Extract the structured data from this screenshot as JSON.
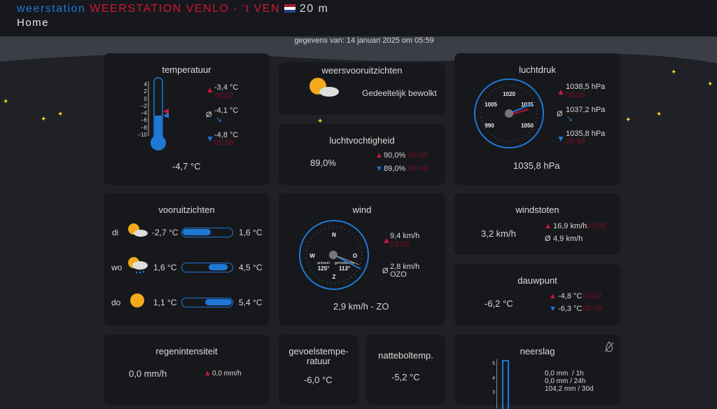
{
  "header": {
    "site": "weerstation",
    "station": "WEERSTATION VENLO - 't VEN",
    "altitude": "20 m",
    "nav": "Home"
  },
  "updated": "gegevens van: 14 januari 2025 om 05:59",
  "colors": {
    "accent": "#1e78d6",
    "high": "#d0153a",
    "time": "#7a0f2a"
  },
  "temperature": {
    "title": "temperatuur",
    "current": "-4,7 °C",
    "current_value": -4.7,
    "scale": [
      "4",
      "2",
      "0",
      "−2",
      "−4",
      "−6",
      "−8",
      "−10"
    ],
    "max": "-3,4 °C",
    "max_time": "00:02",
    "avg_symbol": "Ø",
    "avg": "-4,1 °C",
    "min": "-4,8 °C",
    "min_time": "05:58"
  },
  "forecast": {
    "title": "weersvooruitzichten",
    "text": "Gedeeltelijk bewolkt",
    "icon": "partly-cloudy-icon"
  },
  "humidity": {
    "title": "luchtvochtigheid",
    "current": "89,0%",
    "max": "90,0%",
    "max_time": "00:00",
    "min": "89,0%",
    "min_time": "00:06"
  },
  "pressure": {
    "title": "luchtdruk",
    "current": "1035,8 hPa",
    "current_value": 1035.8,
    "dial": [
      "990",
      "1005",
      "1020",
      "1035",
      "1050"
    ],
    "max": "1038,5 hPa",
    "max_time": "00:09",
    "avg_symbol": "Ø",
    "avg": "1037,2 hPa",
    "min": "1035,8 hPa",
    "min_time": "05:59"
  },
  "outlook": {
    "title": "vooruitzichten",
    "days": [
      {
        "day": "di",
        "icon": "partly-cloudy-icon",
        "min": "-2,7 °C",
        "max": "1,6 °C",
        "range": [
          0,
          0.55
        ]
      },
      {
        "day": "wo",
        "icon": "cloud-rain-icon",
        "min": "1,6 °C",
        "max": "4,5 °C",
        "range": [
          0.52,
          0.88
        ]
      },
      {
        "day": "do",
        "icon": "sun-icon",
        "min": "1,1 °C",
        "max": "5,4 °C",
        "range": [
          0.45,
          1
        ]
      }
    ]
  },
  "wind": {
    "title": "wind",
    "current": "2,9 km/h - ZO",
    "dirs": [
      "N",
      "O",
      "Z",
      "W"
    ],
    "actual_label": "actueel",
    "actual": "125°",
    "avg_label": "gemiddelde",
    "avg": "113°",
    "max": "9,4 km/h",
    "max_time": "03:05",
    "avg_symbol": "Ø",
    "avg_speed": "2,8 km/h",
    "avg_dir": "OZO"
  },
  "gusts": {
    "title": "windstoten",
    "current": "3,2 km/h",
    "max": "16,9 km/h",
    "max_time": "03:05",
    "avg_symbol": "Ø",
    "avg": "4,9 km/h"
  },
  "dewpoint": {
    "title": "dauwpunt",
    "current": "-6,2 °C",
    "max": "-4,8 °C",
    "max_time": "00:02",
    "min": "-6,3 °C",
    "min_time": "05:58"
  },
  "rain_rate": {
    "title": "regenintensiteit",
    "current": "0,0 mm/h",
    "max": "0,0 mm/h"
  },
  "feels": {
    "title": "gevoelstempe-ratuur",
    "current": "-6,0 °C"
  },
  "wetbulb": {
    "title": "natteboltemp.",
    "current": "-5,2 °C"
  },
  "precip": {
    "title": "neerslag",
    "scale": [
      "5",
      "4",
      "3"
    ],
    "h1": "0,0 mm  / 1h",
    "h24": "0,0 mm / 24h",
    "d30": "104,2 mm / 30d"
  }
}
